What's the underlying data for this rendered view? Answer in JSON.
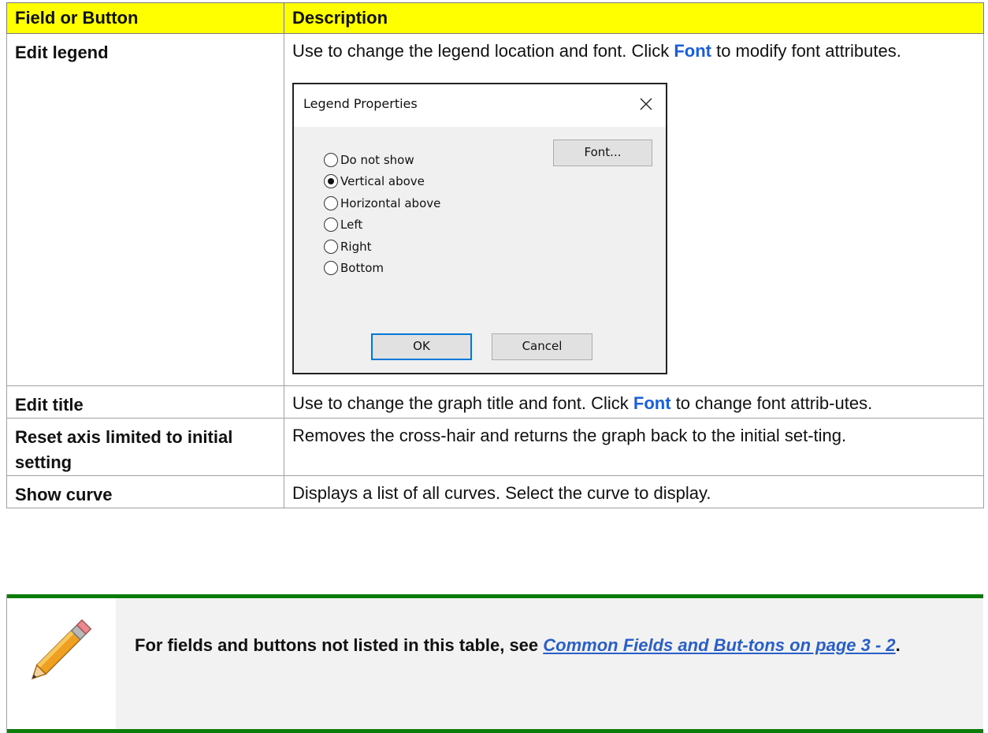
{
  "table": {
    "header": {
      "col1": "Field or Button",
      "col2": "Description"
    },
    "rows": [
      {
        "field": "Edit legend",
        "desc_before": "Use to change the legend location and font. Click ",
        "desc_ref": "Font",
        "desc_after": " to modify font attributes."
      },
      {
        "field": "Edit title",
        "desc_before": "Use to change the graph title and font. Click ",
        "desc_ref": "Font",
        "desc_after": " to change font attrib-utes."
      },
      {
        "field": "Reset axis limited to initial setting",
        "desc": "Removes the cross-hair and returns the graph back to the initial set-ting."
      },
      {
        "field": "Show curve",
        "desc": "Displays a list of all curves. Select the curve to display."
      }
    ]
  },
  "dialog": {
    "title": "Legend Properties",
    "options": [
      {
        "label": "Do not show",
        "selected": false
      },
      {
        "label": "Vertical above",
        "selected": true
      },
      {
        "label": "Horizontal above",
        "selected": false
      },
      {
        "label": "Left",
        "selected": false
      },
      {
        "label": "Right",
        "selected": false
      },
      {
        "label": "Bottom",
        "selected": false
      }
    ],
    "font_button": "Font...",
    "ok_button": "OK",
    "cancel_button": "Cancel"
  },
  "note": {
    "text_before": "For fields and buttons not listed in this table, see ",
    "link_text": "Common Fields and But-tons on page 3 - 2",
    "text_after": "."
  },
  "colors": {
    "header_bg": "#ffff00",
    "link": "#1a5fd8",
    "note_bar": "#0a7d0a",
    "note_panel": "#f2f2f2"
  }
}
